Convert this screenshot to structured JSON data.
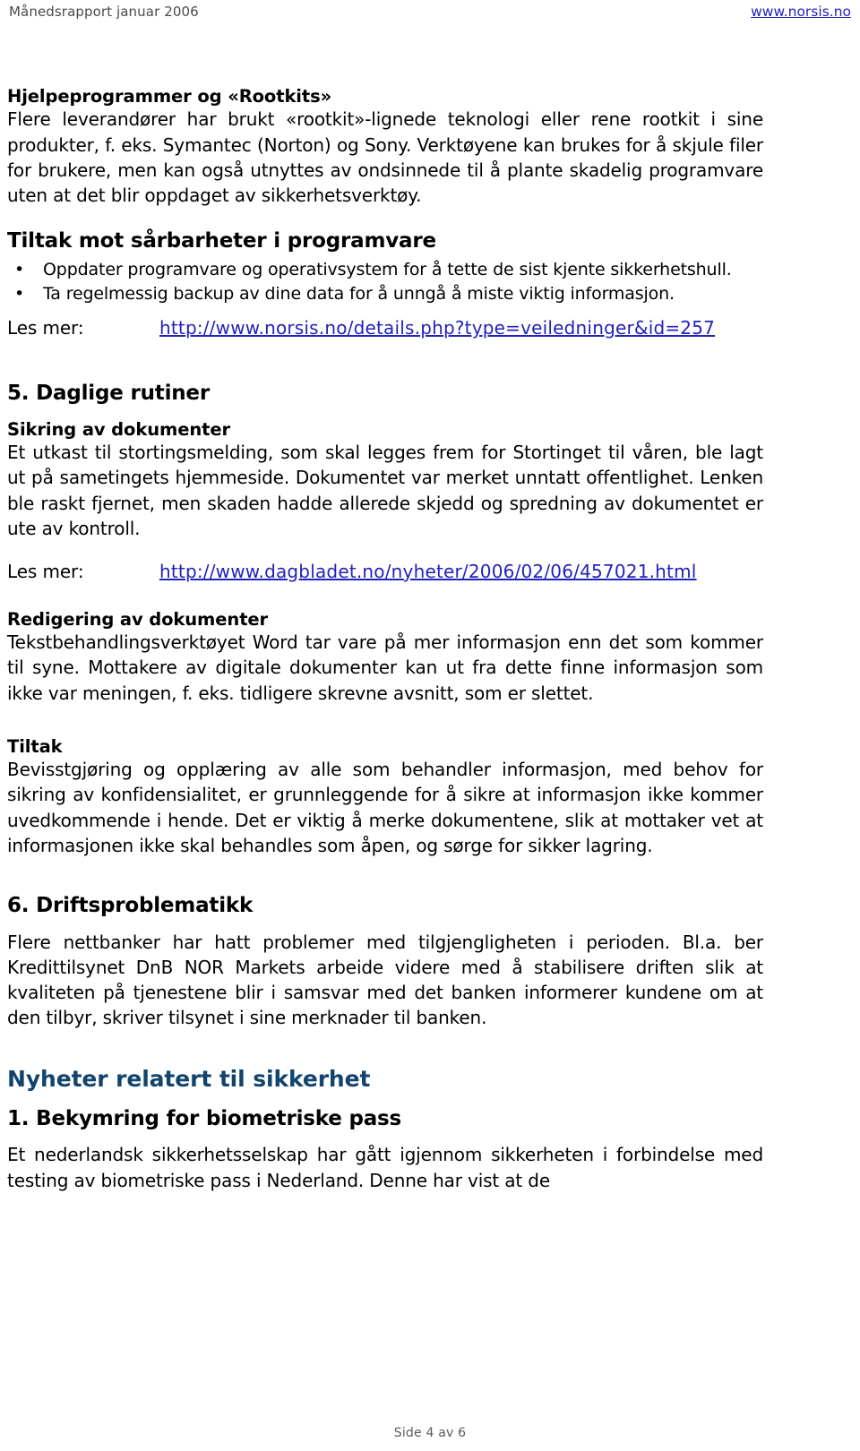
{
  "header": {
    "report_title": "Månedsrapport januar 2006",
    "site_link": "www.norsis.no",
    "link_color": "#2222bb"
  },
  "footer": {
    "page_label": "Side 4 av 6"
  },
  "theme": {
    "heading_blue": "#12446e",
    "link_blue": "#2222bb",
    "text_black": "#000000"
  },
  "sections": {
    "rootkits": {
      "heading": "Hjelpeprogrammer og «Rootkits»",
      "body": "Flere leverandører har brukt «rootkit»-lignede teknologi eller rene rootkit i sine produkter, f. eks. Symantec (Norton) og Sony. Verktøyene kan brukes for å skjule filer for brukere, men kan også utnyttes av ondsinnede til å plante skadelig programvare uten at det blir oppdaget av sikkerhetsverktøy."
    },
    "tiltak_sarbarheter": {
      "heading": "Tiltak mot sårbarheter i programvare",
      "bullet_glyph": "•",
      "items": [
        "Oppdater programvare og operativsystem for å tette de sist kjente sikkerhetshull.",
        "Ta regelmessig backup av dine data for å unngå å miste viktig informasjon."
      ],
      "lesmer_label": "Les mer:",
      "lesmer_url": "http://www.norsis.no/details.php?type=veiledninger&id=257"
    },
    "daglige_rutiner": {
      "heading": "5.  Daglige rutiner",
      "sikring": {
        "heading": "Sikring av dokumenter",
        "body": "Et utkast til stortingsmelding, som skal legges frem for Stortinget til våren, ble lagt ut på sametingets hjemmeside. Dokumentet var merket unntatt offentlighet. Lenken ble raskt fjernet, men skaden hadde allerede skjedd og spredning av dokumentet er ute av kontroll.",
        "lesmer_label": "Les mer:",
        "lesmer_url": "http://www.dagbladet.no/nyheter/2006/02/06/457021.html"
      },
      "redigering": {
        "heading": "Redigering av dokumenter",
        "body": "Tekstbehandlingsverktøyet Word tar vare på mer informasjon enn det som kommer til syne.  Mottakere av digitale dokumenter kan ut fra dette finne informasjon som ikke var meningen, f. eks. tidligere skrevne avsnitt, som er slettet."
      },
      "tiltak": {
        "heading": "Tiltak",
        "body": "Bevisstgjøring og opplæring av alle som behandler informasjon, med behov for sikring av konfidensialitet, er grunnleggende for å sikre at informasjon ikke kommer uvedkommende i hende. Det er viktig å merke dokumentene, slik at mottaker vet at informasjonen ikke skal behandles som åpen, og sørge for sikker lagring."
      }
    },
    "driftsproblematikk": {
      "heading": "6.  Driftsproblematikk",
      "body": "Flere nettbanker har hatt problemer med tilgjengligheten i perioden. Bl.a. ber Kredittilsynet DnB NOR Markets arbeide videre med å stabilisere driften slik at kvaliteten på tjenestene blir i samsvar med det banken informerer kundene om at den tilbyr, skriver tilsynet i sine merknader til banken."
    },
    "nyheter": {
      "heading": "Nyheter relatert til sikkerhet",
      "item1": {
        "heading": "1.  Bekymring for biometriske pass",
        "body": "Et nederlandsk sikkerhetsselskap har gått igjennom sikkerheten i forbindelse med testing av biometriske pass i Nederland. Denne har vist at de"
      }
    }
  }
}
